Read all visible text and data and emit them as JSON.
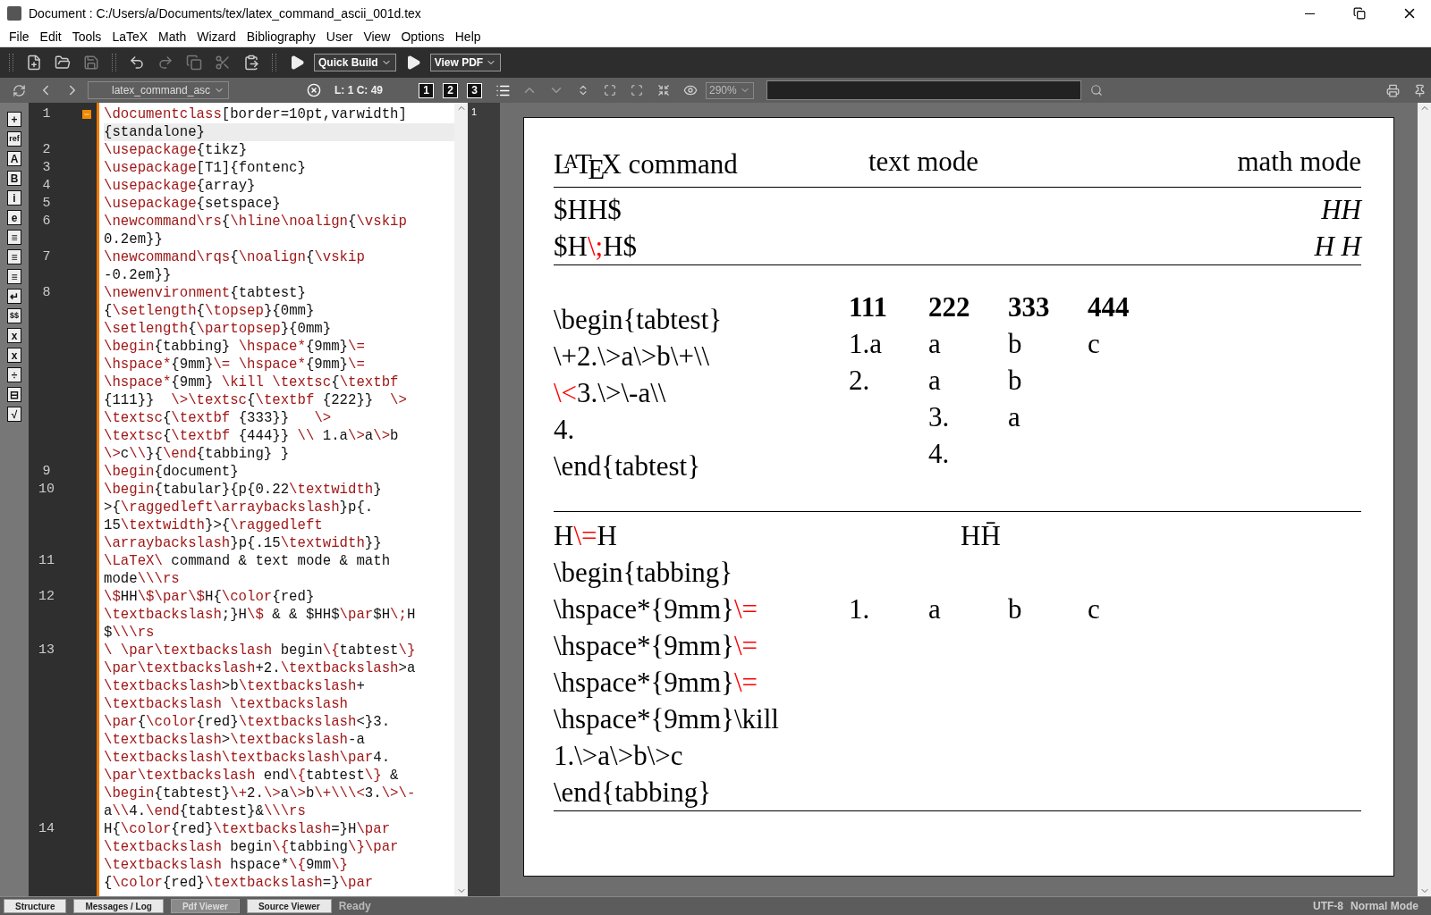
{
  "window": {
    "title": "Document : C:/Users/a/Documents/tex/latex_command_ascii_001d.tex"
  },
  "menu": [
    "File",
    "Edit",
    "Tools",
    "LaTeX",
    "Math",
    "Wizard",
    "Bibliography",
    "User",
    "View",
    "Options",
    "Help"
  ],
  "toolbar": {
    "build": "Quick Build",
    "view": "View PDF"
  },
  "editor_bar": {
    "tab": "latex_command_asc",
    "position": "L: 1 C: 49",
    "views": [
      "1",
      "2",
      "3"
    ],
    "zoom": "290%"
  },
  "side_tools": [
    {
      "glyph": "+"
    },
    {
      "glyph": "ref"
    },
    {
      "glyph": "A"
    },
    {
      "glyph": "B"
    },
    {
      "glyph": "i"
    },
    {
      "glyph": "e"
    },
    {
      "glyph": "≡"
    },
    {
      "glyph": "≡"
    },
    {
      "glyph": "≡"
    },
    {
      "glyph": "↵"
    },
    {
      "glyph": "$$"
    },
    {
      "glyph": "x"
    },
    {
      "glyph": "x"
    },
    {
      "glyph": "÷"
    },
    {
      "glyph": "⊟"
    },
    {
      "glyph": "√"
    }
  ],
  "code": [
    {
      "number": "1",
      "current": true,
      "foldable": true,
      "rows": [
        "\\documentclass[border=10pt,varwidth]",
        "{standalone}"
      ]
    },
    {
      "number": "2",
      "current": false,
      "foldable": false,
      "rows": [
        "\\usepackage{tikz}"
      ]
    },
    {
      "number": "3",
      "current": false,
      "foldable": false,
      "rows": [
        "\\usepackage[T1]{fontenc}"
      ]
    },
    {
      "number": "4",
      "current": false,
      "foldable": false,
      "rows": [
        "\\usepackage{array}"
      ]
    },
    {
      "number": "5",
      "current": false,
      "foldable": false,
      "rows": [
        "\\usepackage{setspace}"
      ]
    },
    {
      "number": "6",
      "current": false,
      "foldable": false,
      "rows": [
        "\\newcommand\\rs{\\hline\\noalign{\\vskip",
        "0.2em}}"
      ]
    },
    {
      "number": "7",
      "current": false,
      "foldable": false,
      "rows": [
        "\\newcommand\\rqs{\\noalign{\\vskip",
        "-0.2em}}"
      ]
    },
    {
      "number": "8",
      "current": false,
      "foldable": false,
      "rows": [
        "\\newenvironment{tabtest}",
        "{\\setlength{\\topsep}{0mm}",
        "\\setlength{\\partopsep}{0mm}",
        "\\begin{tabbing} \\hspace*{9mm}\\=",
        "\\hspace*{9mm}\\= \\hspace*{9mm}\\=",
        "\\hspace*{9mm} \\kill \\textsc{\\textbf",
        "{111}}  \\>\\textsc{\\textbf {222}}  \\>",
        "\\textsc{\\textbf {333}}   \\>",
        "\\textsc{\\textbf {444}} \\\\ 1.a\\>a\\>b",
        "\\>c\\\\}{\\end{tabbing} }"
      ]
    },
    {
      "number": "9",
      "current": false,
      "foldable": false,
      "rows": [
        "\\begin{document}"
      ]
    },
    {
      "number": "10",
      "current": false,
      "foldable": false,
      "rows": [
        "\\begin{tabular}{p{0.22\\textwidth}",
        ">{\\raggedleft\\arraybackslash}p{.",
        "15\\textwidth}>{\\raggedleft",
        "\\arraybackslash}p{.15\\textwidth}}"
      ]
    },
    {
      "number": "11",
      "current": false,
      "foldable": false,
      "rows": [
        "\\LaTeX\\ command & text mode & math",
        "mode\\\\\\rs"
      ]
    },
    {
      "number": "12",
      "current": false,
      "foldable": false,
      "rows": [
        "\\$HH\\$\\par\\$H{\\color{red}",
        "\\textbackslash;}H\\$ & & $HH$\\par$H\\;H",
        "$\\\\\\rs"
      ]
    },
    {
      "number": "13",
      "current": false,
      "foldable": false,
      "rows": [
        "\\ \\par\\textbackslash begin\\{tabtest\\}",
        "\\par\\textbackslash+2.\\textbackslash>a",
        "\\textbackslash>b\\textbackslash+",
        "\\textbackslash \\textbackslash",
        "\\par{\\color{red}\\textbackslash<}3.",
        "\\textbackslash>\\textbackslash-a",
        "\\textbackslash\\textbackslash\\par4.",
        "\\par\\textbackslash end\\{tabtest\\} &",
        "\\begin{tabtest}\\+2.\\>a\\>b\\+\\\\\\<3.\\>\\-",
        "a\\\\4.\\end{tabtest}&\\\\\\rs"
      ]
    },
    {
      "number": "14",
      "current": false,
      "foldable": false,
      "rows": [
        "H{\\color{red}\\textbackslash=}H\\par",
        "\\textbackslash begin\\{tabbing\\}\\par",
        "\\textbackslash hspace*\\{9mm\\}",
        "{\\color{red}\\textbackslash=}\\par"
      ]
    }
  ],
  "pdf_gutter_label": "1",
  "table": {
    "header": [
      "L$^{A}$T$_{E}$X command",
      "text mode",
      "math mode"
    ],
    "math_rows": [
      {
        "source": [
          {
            "t": "$HH$",
            "red": false
          }
        ],
        "math": "HH"
      },
      {
        "source": [
          {
            "t": "$H",
            "red": false
          },
          {
            "t": "\\;",
            "red": true
          },
          {
            "t": "H$",
            "red": false
          }
        ],
        "math": "H H"
      }
    ],
    "tabtest_row": {
      "source_lines": [
        [
          {
            "t": "\\begin{tabtest}",
            "red": false
          }
        ],
        [
          {
            "t": "\\+2.\\>a\\>b\\+\\\\",
            "red": false
          }
        ],
        [
          {
            "t": "\\<",
            "red": true
          },
          {
            "t": "3.\\>\\-a\\\\",
            "red": false
          }
        ],
        [
          {
            "t": "4.",
            "red": false
          }
        ],
        [
          {
            "t": "\\end{tabtest}",
            "red": false
          }
        ]
      ],
      "tabbing_header": [
        "111",
        "222",
        "333",
        "444"
      ],
      "tabbing_rows": [
        {
          "indented": false,
          "cells": [
            "1.a",
            "a",
            "b",
            "c"
          ]
        },
        {
          "indented": false,
          "cells": [
            "2.",
            "a",
            "b"
          ]
        },
        {
          "indented": true,
          "cells": [
            "3.",
            "a"
          ]
        },
        {
          "indented": true,
          "cells": [
            "4."
          ]
        }
      ]
    },
    "tabbing_row": {
      "source_lines": [
        [
          {
            "t": "H",
            "red": false
          },
          {
            "t": "\\=",
            "red": true
          },
          {
            "t": "H",
            "red": false
          }
        ],
        [
          {
            "t": "\\begin{tabbing}",
            "red": false
          }
        ],
        [
          {
            "t": "\\hspace*{9mm}",
            "red": false
          },
          {
            "t": "\\=",
            "red": true
          }
        ],
        [
          {
            "t": "\\hspace*{9mm}",
            "red": false
          },
          {
            "t": "\\=",
            "red": true
          }
        ],
        [
          {
            "t": "\\hspace*{9mm}",
            "red": false
          },
          {
            "t": "\\=",
            "red": true
          }
        ],
        [
          {
            "t": "\\hspace*{9mm}\\kill",
            "red": false
          }
        ],
        [
          {
            "t": "1.\\>a\\>b\\>c",
            "red": false
          }
        ],
        [
          {
            "t": "\\end{tabbing}",
            "red": false
          }
        ]
      ],
      "result": "HH̄",
      "tabbing_rows": [
        {
          "indented": false,
          "cells": [
            "1.",
            "a",
            "b",
            "c"
          ]
        }
      ]
    }
  },
  "bottom_tabs": [
    {
      "label": "Structure",
      "selected": false
    },
    {
      "label": "Messages / Log",
      "selected": false
    },
    {
      "label": "Pdf Viewer",
      "selected": true
    },
    {
      "label": "Source Viewer",
      "selected": false
    }
  ],
  "status": {
    "message": "Ready",
    "encoding": "UTF-8",
    "mode": "Normal Mode"
  }
}
